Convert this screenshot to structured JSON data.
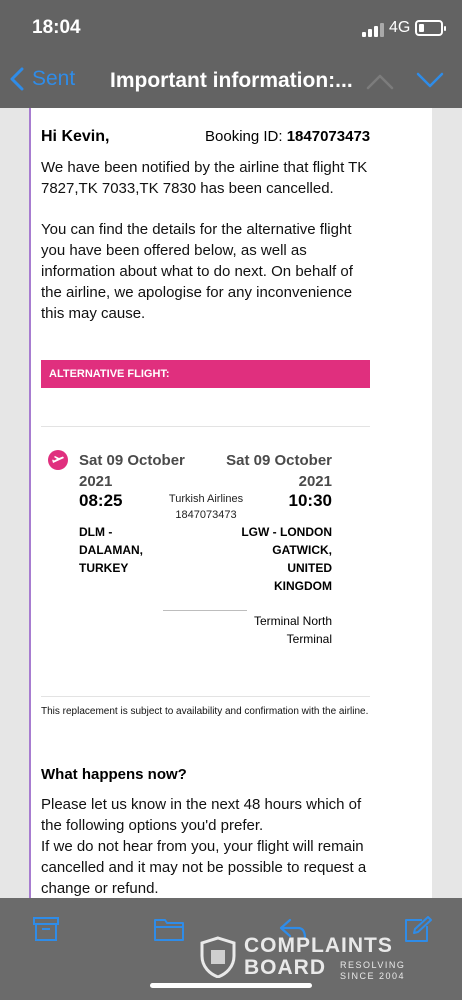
{
  "status_bar": {
    "time": "18:04",
    "network": "4G"
  },
  "nav": {
    "back_label": "Sent",
    "title": "Important information:..."
  },
  "email": {
    "greeting": "Hi Kevin,",
    "booking_label": "Booking ID:",
    "booking_id": "1847073473",
    "para1": "We have been notified by the airline that flight TK 7827,TK 7033,TK 7830 has been cancelled.",
    "para2": "You can find the details for the alternative flight you have been offered below, as well as information about what to do next. On behalf of the airline, we apologise for any inconvenience this may cause.",
    "alt_banner": "ALTERNATIVE FLIGHT:",
    "flight": {
      "dep_date": "Sat 09 October 2021",
      "dep_time": "08:25",
      "dep_airport": "DLM - DALAMAN, TURKEY",
      "airline": "Turkish Airlines",
      "airline_ref": "1847073473",
      "arr_date": "Sat 09 October 2021",
      "arr_time": "10:30",
      "arr_airport": "LGW - LONDON GATWICK, UNITED KINGDOM",
      "arr_terminal": "Terminal North Terminal"
    },
    "replacement_note": "This replacement is subject to availability and confirmation with the airline.",
    "what_happens_heading": "What happens now?",
    "para3": "Please let us know in the next 48 hours which of the following options you'd prefer.",
    "para4": "If we do not hear from you, your flight will remain cancelled and it may not be possible to request a change or refund."
  },
  "toolbar": {
    "icons": [
      "archive-icon",
      "folder-icon",
      "reply-icon",
      "compose-icon"
    ]
  },
  "watermark": {
    "line1": "COMPLAINTS",
    "line2": "BOARD",
    "sub1": "RESOLVING",
    "sub2": "SINCE 2004"
  }
}
